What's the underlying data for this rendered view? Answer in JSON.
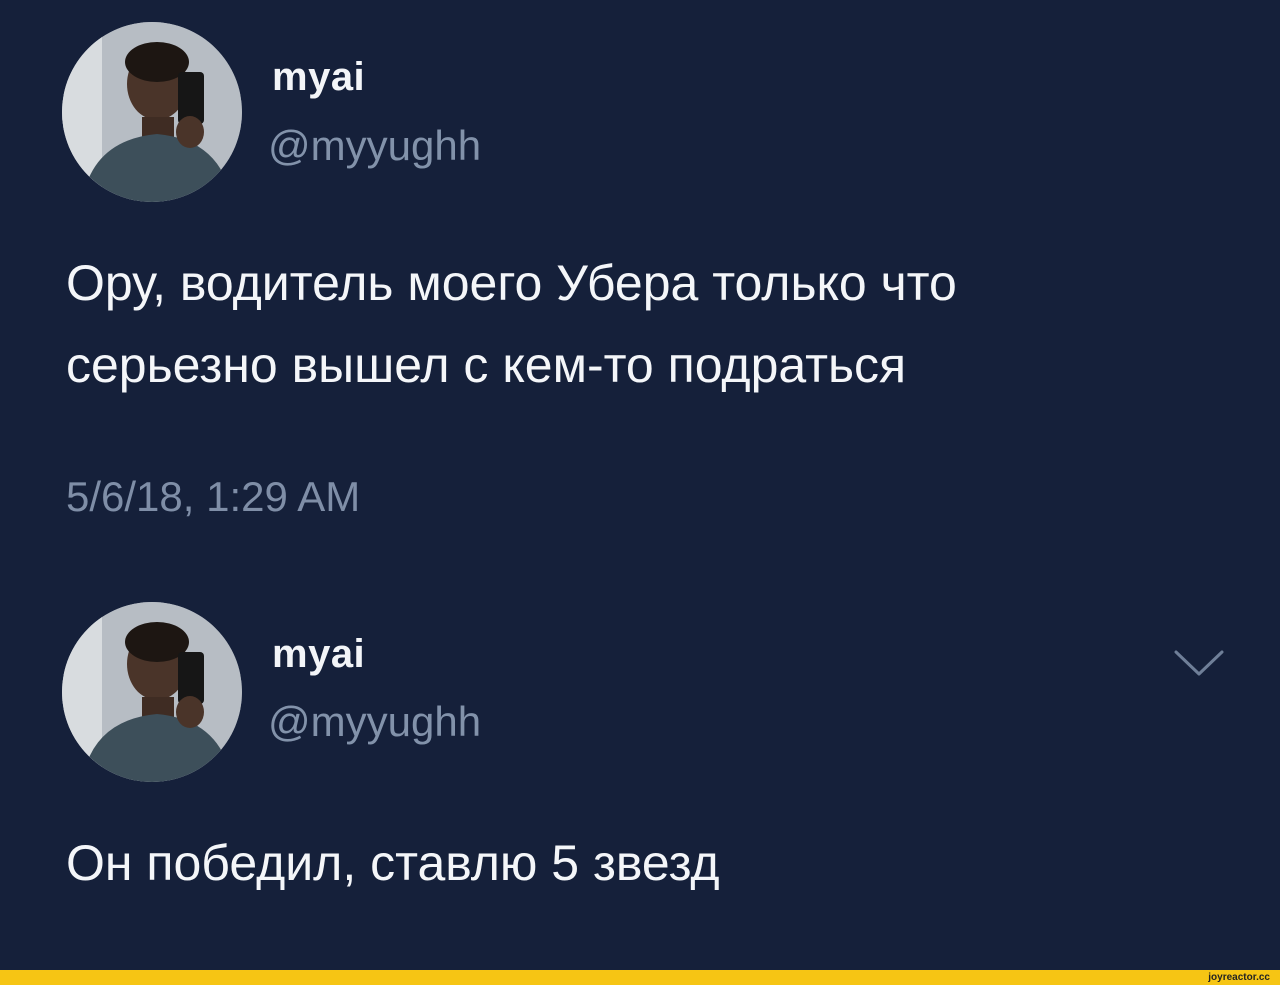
{
  "tweets": [
    {
      "user": {
        "display_name": "myai",
        "handle": "@myyughh",
        "avatar_icon": "profile-photo-avatar"
      },
      "text_lines": [
        "Ору, водитель моего Убера только что",
        "серьезно вышел с кем-то подраться"
      ],
      "timestamp": "5/6/18, 1:29 AM"
    },
    {
      "user": {
        "display_name": "myai",
        "handle": "@myyughh",
        "avatar_icon": "profile-photo-avatar"
      },
      "text_lines": [
        "Он победил, ставлю 5 звезд"
      ],
      "menu_icon": "chevron-down-icon"
    }
  ],
  "footer": {
    "watermark": "joyreactor.cc",
    "bar_color": "#f6c514"
  },
  "colors": {
    "background": "#15203a",
    "handle": "#8292aa",
    "text": "#f4f6f9"
  }
}
